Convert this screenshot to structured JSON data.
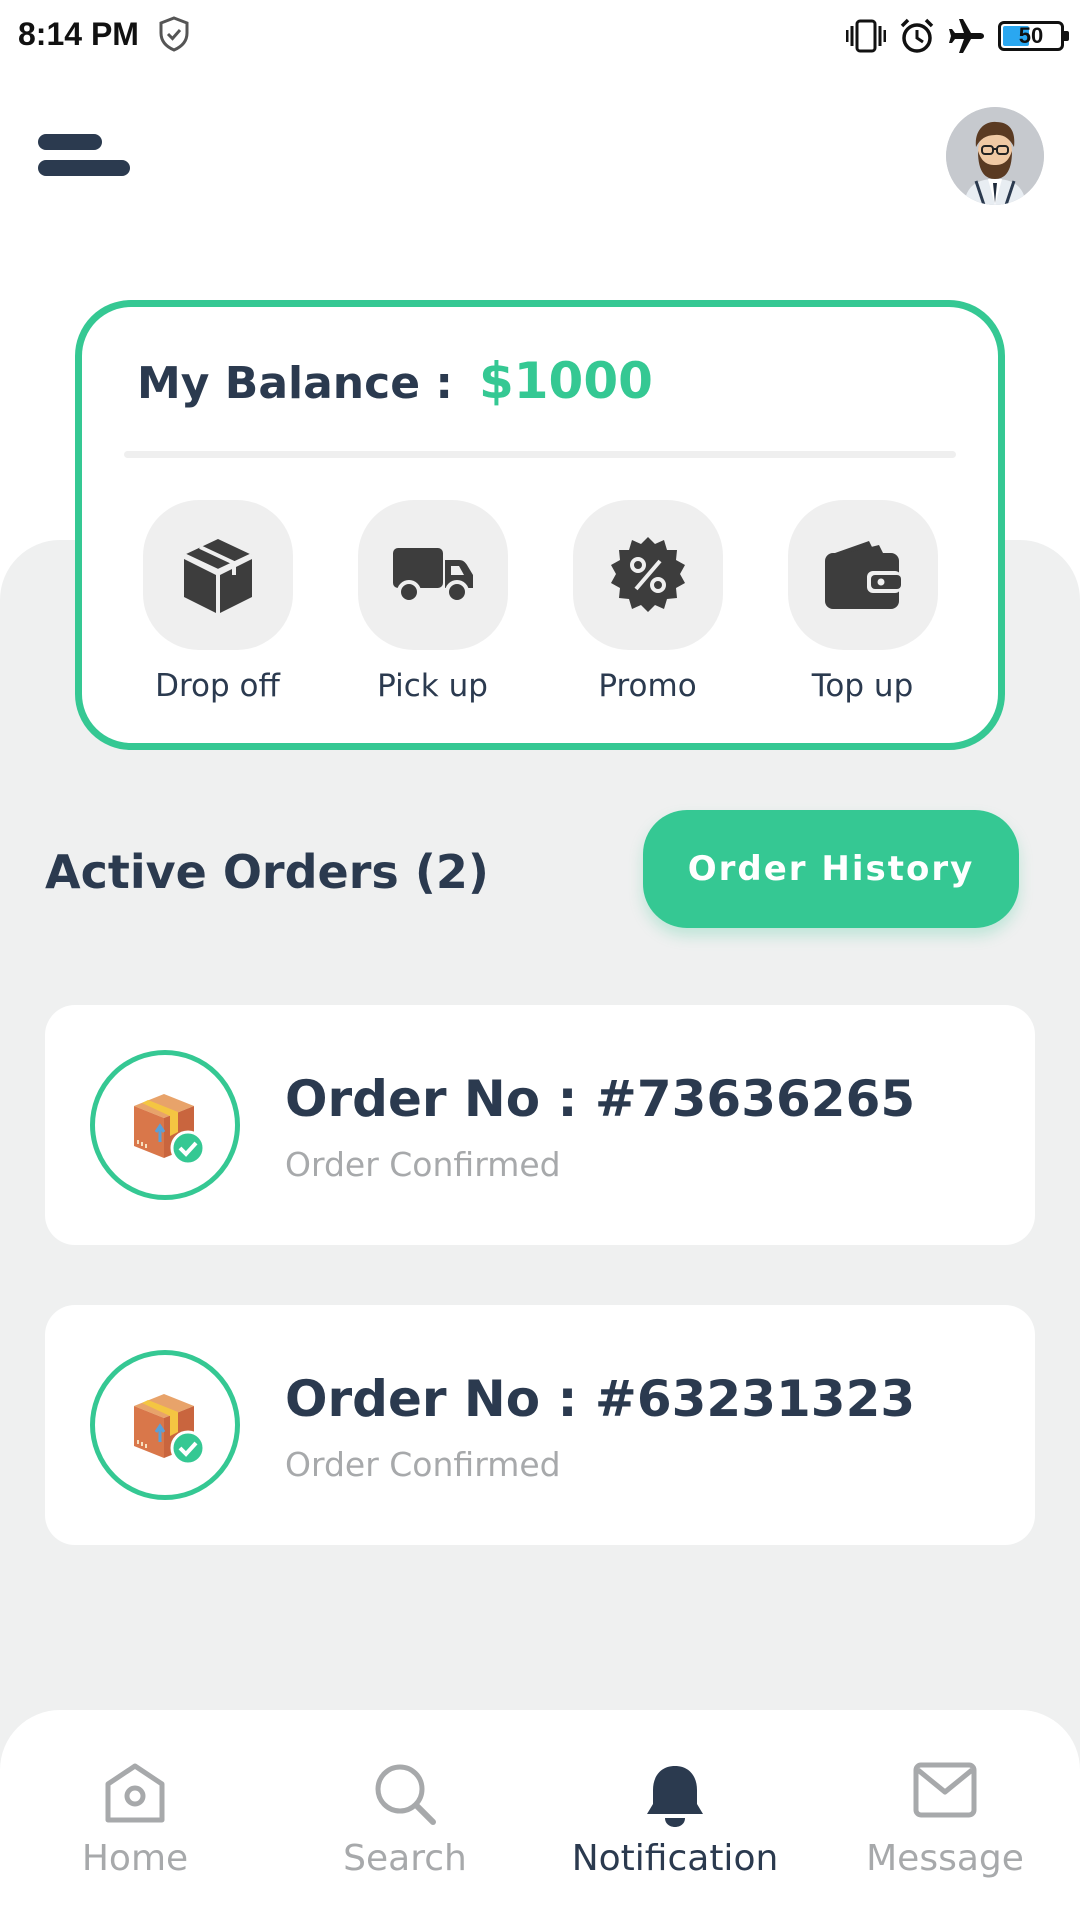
{
  "status_bar": {
    "time": "8:14 PM",
    "battery_level": "50",
    "battery_percent": 50,
    "icons": [
      "shield-check-icon",
      "vibrate-icon",
      "alarm-icon",
      "airplane-icon",
      "battery-icon"
    ]
  },
  "header": {
    "menu_icon": "menu-icon",
    "avatar": "user-avatar"
  },
  "balance": {
    "label": "My Balance :",
    "amount": "$1000"
  },
  "actions": [
    {
      "label": "Drop off",
      "icon": "box-icon"
    },
    {
      "label": "Pick up",
      "icon": "truck-icon"
    },
    {
      "label": "Promo",
      "icon": "percent-badge-icon"
    },
    {
      "label": "Top up",
      "icon": "wallet-icon"
    }
  ],
  "orders": {
    "title": "Active Orders (2)",
    "history_button": "Order History",
    "items": [
      {
        "number": "Order No : #73636265",
        "status": "Order Confirmed"
      },
      {
        "number": "Order No : #63231323",
        "status": "Order Confirmed"
      }
    ]
  },
  "nav": {
    "active": "Notification",
    "items": [
      {
        "label": "Home",
        "icon": "home-icon"
      },
      {
        "label": "Search",
        "icon": "search-icon"
      },
      {
        "label": "Notification",
        "icon": "bell-icon"
      },
      {
        "label": "Message",
        "icon": "mail-icon"
      }
    ]
  },
  "colors": {
    "accent": "#35c893",
    "text_dark": "#2b3a4f",
    "text_muted": "#a7a9ab",
    "background": "#eff0f0"
  }
}
